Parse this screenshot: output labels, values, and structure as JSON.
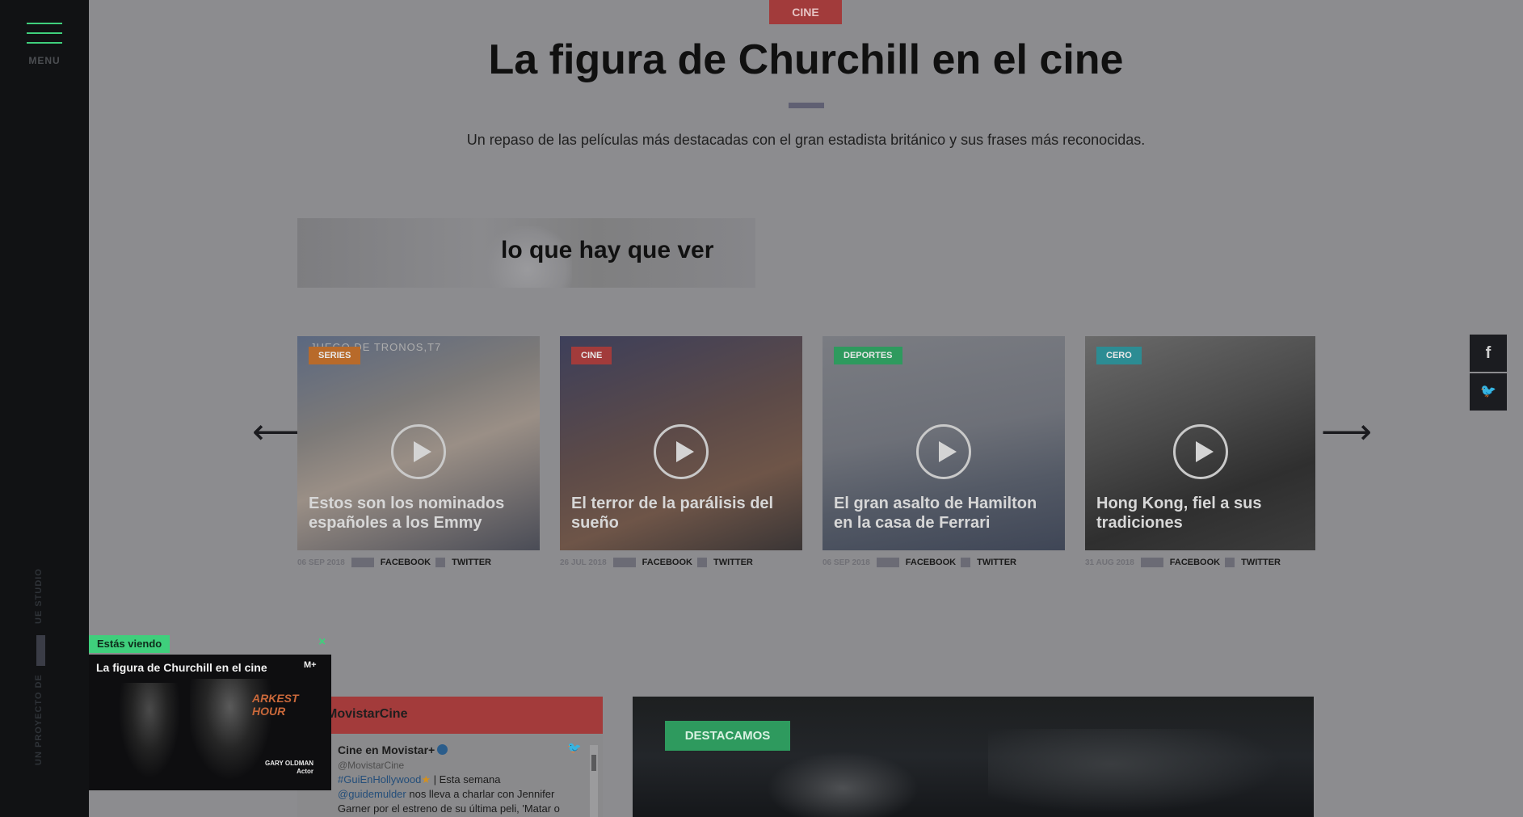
{
  "sidebar": {
    "menu_label": "MENU",
    "vertical_studio": "UE STUDIO",
    "vertical_project": "UN PROYECTO DE"
  },
  "header": {
    "category": "CINE",
    "title": "La figura de Churchill en el cine",
    "subtitle": "Un repaso de las películas más destacadas con el gran estadista británico y sus frases más reconocidas."
  },
  "banner": {
    "text": "lo que hay que ver"
  },
  "carousel": {
    "prev_icon": "arrow-left-icon",
    "next_icon": "arrow-right-icon",
    "cards": [
      {
        "tag": "SERIES",
        "tag_color": "#b86a2a",
        "overlay": "JUEGO DE TRONOS,T7",
        "title": "Estos son los nominados españoles a los Emmy",
        "date": "06 SEP 2018",
        "facebook": "FACEBOOK",
        "twitter": "TWITTER",
        "bg": "linear-gradient(160deg,#5b6880 0%,#7d7a78 35%,#9a8f86 55%,#4a4c56 100%)"
      },
      {
        "tag": "CINE",
        "tag_color": "#a23b3b",
        "overlay": "",
        "title": "El terror de la parálisis del sueño",
        "date": "26 JUL 2018",
        "facebook": "FACEBOOK",
        "twitter": "TWITTER",
        "bg": "linear-gradient(160deg,#3d3f5a 0%,#5c4a48 45%,#6e5548 70%,#3a3535 100%)"
      },
      {
        "tag": "DEPORTES",
        "tag_color": "#2e9a5e",
        "overlay": "",
        "title": "El gran asalto de Hamilton en la casa de Ferrari",
        "date": "06 SEP 2018",
        "facebook": "FACEBOOK",
        "twitter": "TWITTER",
        "bg": "linear-gradient(170deg,#7a7c82 0%,#6d7078 45%,#545a66 70%,#3f4656 100%)"
      },
      {
        "tag": "CERO",
        "tag_color": "#2c8c93",
        "overlay": "",
        "title": "Hong Kong, fiel a sus tradiciones",
        "date": "31 AUG 2018",
        "facebook": "FACEBOOK",
        "twitter": "TWITTER",
        "bg": "linear-gradient(160deg,#6a6a6a 0%,#4b4b4b 40%,#2f2f2f 70%,#3c3c3c 100%)"
      }
    ]
  },
  "social": {
    "facebook_icon": "f",
    "twitter_icon": "🐦"
  },
  "twitter_widget": {
    "header": "MovistarCine",
    "account_name": "Cine en Movistar+",
    "handle": "@MovistarCine",
    "hashtag": "#GuiEnHollywood",
    "tweet_part1": " | Esta semana",
    "mention": "@guidemulder",
    "tweet_part2": " nos lleva a charlar con Jennifer Garner por el estreno de su última peli, 'Matar o"
  },
  "destacamos": {
    "badge": "DESTACAMOS"
  },
  "mini_player": {
    "label": "Estás viendo",
    "close": "×",
    "title": "La figura de Churchill en el cine",
    "logo": "M+",
    "poster_text": "ARKEST HOUR",
    "caption_name": "GARY OLDMAN",
    "caption_role": "Actor"
  }
}
